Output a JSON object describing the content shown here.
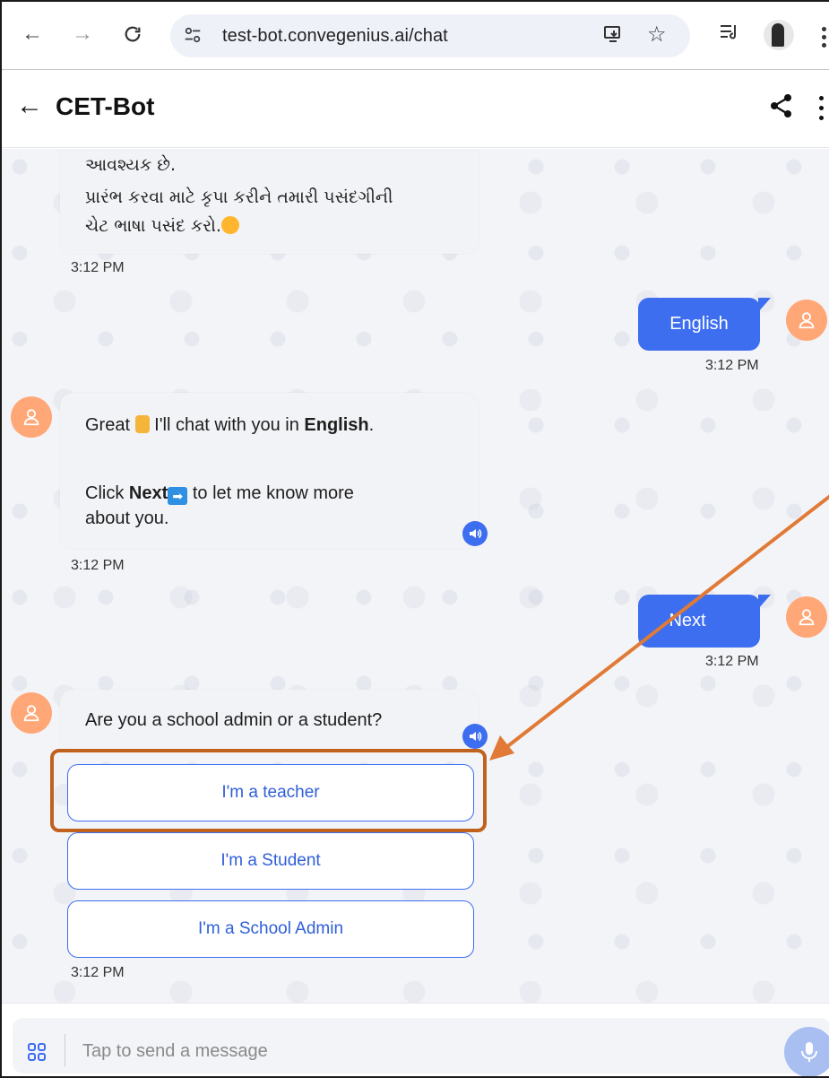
{
  "browser": {
    "url": "test-bot.convegenius.ai/chat",
    "icons": [
      "back-icon",
      "forward-icon",
      "reload-icon",
      "site-settings-icon",
      "install-app-icon",
      "bookmark-star-icon",
      "reading-list-icon",
      "profile-avatar",
      "browser-menu-icon"
    ]
  },
  "header": {
    "title": "CET-Bot",
    "back_icon": "←",
    "icons": [
      "share-icon",
      "more-vert-icon"
    ]
  },
  "messages": {
    "m1": {
      "line1": "આવશ્યક છે.",
      "line2": "પ્રારંભ કરવા માટે કૃપા કરીને તમારી પસંદગીની",
      "line3": "ચેટ ભાષા પસંદ કરો.",
      "time": "3:12 PM"
    },
    "m2": {
      "text": "English",
      "time": "3:12 PM"
    },
    "m3": {
      "part1": "Great",
      "part2": "I'll chat with you in",
      "bold": "English",
      "period": ".",
      "click": "Click",
      "next_bold": "Next",
      "rest1": "to let me know more",
      "rest2": "about you.",
      "time": "3:12 PM"
    },
    "m4": {
      "text": "Next",
      "time": "3:12 PM"
    },
    "m5": {
      "text": "Are you a school admin or a student?",
      "options": [
        "I'm a teacher",
        "I'm a Student",
        "I'm a School Admin"
      ],
      "time": "3:12 PM"
    }
  },
  "composer": {
    "placeholder": "Tap to send a message"
  },
  "colors": {
    "accent": "#3d6ef0",
    "avatar": "#ffa777",
    "annotation": "#c0611e"
  }
}
